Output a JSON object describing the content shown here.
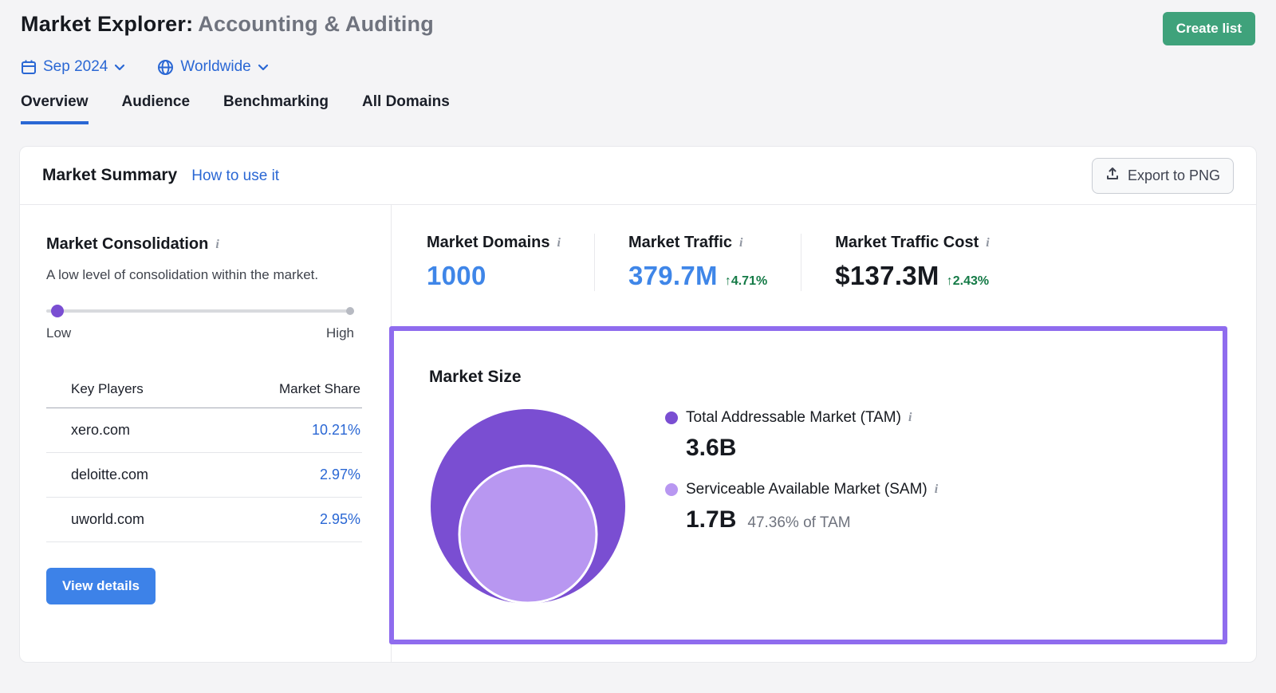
{
  "header": {
    "title_prefix": "Market Explorer:",
    "title_suffix": "Accounting & Auditing",
    "create_list_label": "Create list",
    "date_filter": "Sep 2024",
    "region_filter": "Worldwide"
  },
  "tabs": [
    {
      "label": "Overview",
      "active": true
    },
    {
      "label": "Audience",
      "active": false
    },
    {
      "label": "Benchmarking",
      "active": false
    },
    {
      "label": "All Domains",
      "active": false
    }
  ],
  "market_summary": {
    "title": "Market Summary",
    "help_link": "How to use it",
    "export_label": "Export to PNG"
  },
  "consolidation": {
    "title": "Market Consolidation",
    "description": "A low level of consolidation within the market.",
    "slider_low_label": "Low",
    "slider_high_label": "High",
    "table": {
      "headers": [
        "Key Players",
        "Market Share"
      ],
      "rows": [
        {
          "player": "xero.com",
          "share": "10.21%"
        },
        {
          "player": "deloitte.com",
          "share": "2.97%"
        },
        {
          "player": "uworld.com",
          "share": "2.95%"
        }
      ]
    },
    "view_details_label": "View details"
  },
  "stats": [
    {
      "label": "Market Domains",
      "value": "1000",
      "change": ""
    },
    {
      "label": "Market Traffic",
      "value": "379.7M",
      "change": "↑4.71%"
    },
    {
      "label": "Market Traffic Cost",
      "value": "$137.3M",
      "change": "↑2.43%"
    }
  ],
  "market_size": {
    "title": "Market Size",
    "tam": {
      "label": "Total Addressable Market (TAM)",
      "value": "3.6B"
    },
    "sam": {
      "label": "Serviceable Available Market (SAM)",
      "value": "1.7B",
      "note": "47.36% of TAM"
    }
  },
  "colors": {
    "brand_blue": "#2a67d4",
    "value_blue": "#3f86e8",
    "positive_green": "#147a46",
    "create_button_green": "#3fa27b",
    "tam_purple": "#7a4ed2",
    "sam_purple": "#b897f1",
    "highlight_border_purple": "#8f6cee"
  }
}
